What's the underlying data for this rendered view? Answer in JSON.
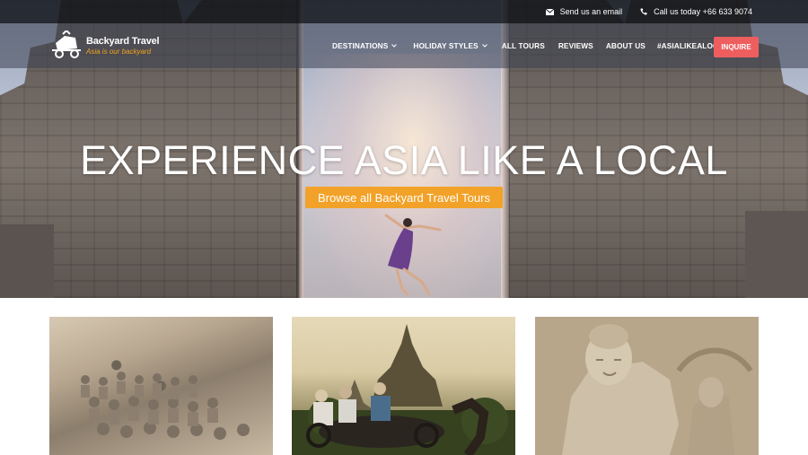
{
  "topbar": {
    "email_label": "Send us an email",
    "email_icon": "envelope-icon",
    "phone_label": "Call us today +66 633 9074",
    "phone_icon": "phone-icon"
  },
  "logo": {
    "title": "Backyard Travel",
    "tagline": "Asia is our backyard"
  },
  "nav": {
    "items": [
      {
        "label": "DESTINATIONS",
        "has_dropdown": true
      },
      {
        "label": "HOLIDAY STYLES",
        "has_dropdown": true
      },
      {
        "label": "ALL TOURS",
        "has_dropdown": false
      },
      {
        "label": "REVIEWS",
        "has_dropdown": false
      },
      {
        "label": "ABOUT US",
        "has_dropdown": false
      },
      {
        "label": "#ASIALIKEALOCAL",
        "has_dropdown": false
      }
    ],
    "cta_label": "INQUIRE"
  },
  "hero": {
    "title": "EXPERIENCE ASIA LIKE A LOCAL",
    "cta_label": "Browse all Backyard Travel Tours"
  },
  "colors": {
    "accent_orange": "#f2a228",
    "inquire_red": "#ee5e5f",
    "topbar_bg": "#14161c"
  }
}
